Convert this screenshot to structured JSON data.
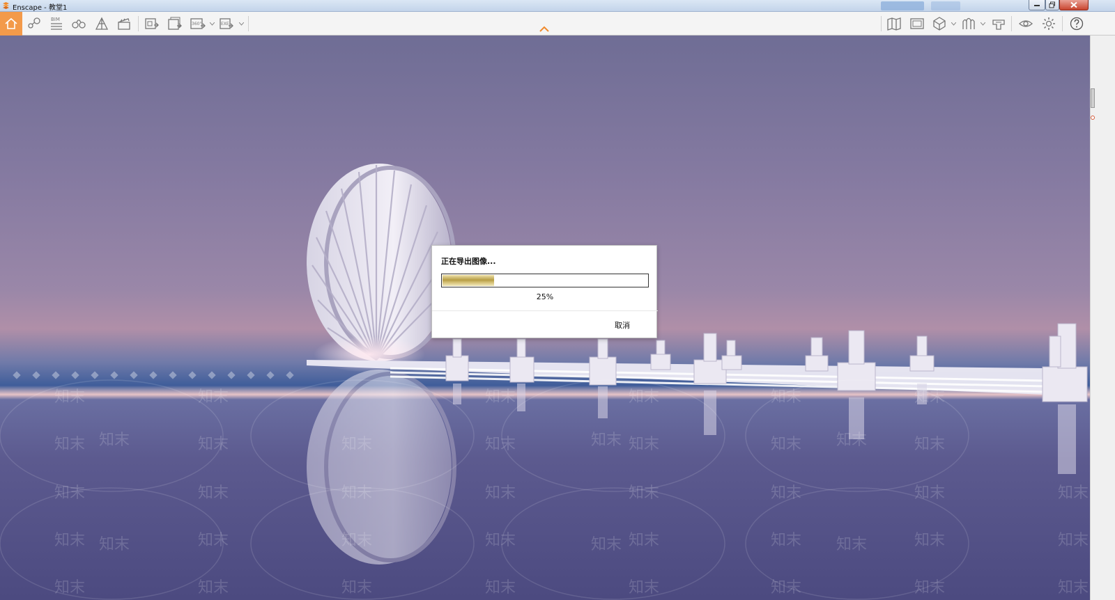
{
  "window": {
    "title": "Enscape - 教堂1",
    "colors": {
      "titlebar": "#c3d4ea",
      "close": "#c9452f"
    }
  },
  "toolbar": {
    "left_icons": [
      "home-icon",
      "pin-icon",
      "bim-icon",
      "binoculars-icon",
      "perspective-icon",
      "clapper-icon",
      "screenshot-icon",
      "batch-render-icon",
      "panorama-360-icon",
      "exe-export-icon"
    ],
    "right_icons": [
      "map-icon",
      "asset-library-icon",
      "cube-icon",
      "material-icon",
      "export-settings-icon",
      "eye-icon",
      "gear-icon",
      "help-icon"
    ],
    "bim_label": "BIM",
    "pano_label": "360°",
    "exe_label": "EXE",
    "accent": "#f39a4a"
  },
  "modal": {
    "message": "正在导出图像...",
    "progress": 0.25,
    "progress_label": "25%",
    "cancel_label": "取消"
  },
  "watermark": {
    "text": "知末",
    "color": "#ffffff"
  }
}
